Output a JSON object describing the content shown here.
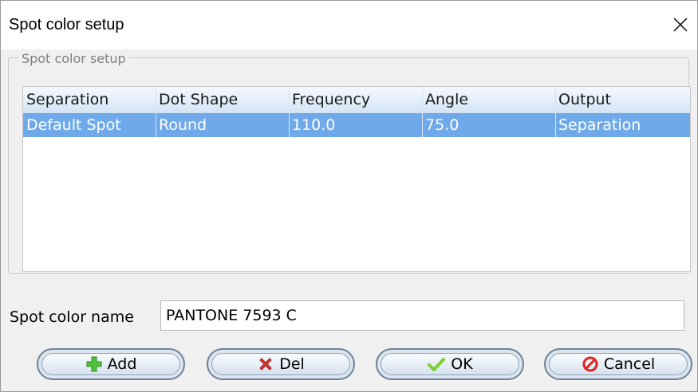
{
  "window": {
    "title": "Spot color setup"
  },
  "group": {
    "legend": "Spot color setup"
  },
  "table": {
    "columns": [
      "Separation",
      "Dot Shape",
      "Frequency",
      "Angle",
      "Output"
    ],
    "rows": [
      [
        "Default Spot",
        "Round",
        "110.0",
        "75.0",
        "Separation"
      ]
    ]
  },
  "spot_name": {
    "label": "Spot color name",
    "value": "PANTONE 7593 C"
  },
  "buttons": {
    "add": "Add",
    "del": "Del",
    "ok": "OK",
    "cancel": "Cancel"
  },
  "colors": {
    "selected_row": "#6fa9ea",
    "header_gradient_top": "#f4f9fe",
    "header_gradient_bottom": "#d2e4f4",
    "add_icon": "#4fc23a",
    "del_icon": "#e03a3a",
    "ok_icon": "#7ccf2f",
    "cancel_icon": "#e02222"
  },
  "icons": {
    "close": "close-icon",
    "add": "plus-icon",
    "del": "delete-icon",
    "ok": "checkmark-icon",
    "cancel": "cancel-icon"
  }
}
